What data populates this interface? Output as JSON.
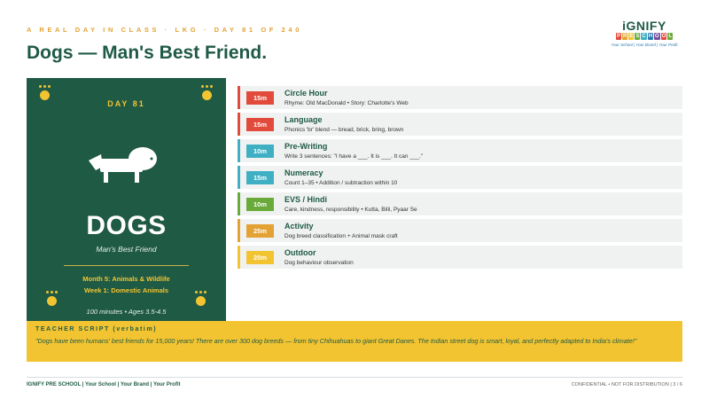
{
  "header": {
    "eyebrow": "A REAL DAY IN CLASS  ·  LKG  ·  DAY 81 OF 240",
    "title": "Dogs — Man's Best Friend."
  },
  "logo": {
    "word": "iGNIFY",
    "sub_letters": [
      "P",
      "R",
      "E",
      "S",
      "C",
      "H",
      "O",
      "O",
      "L"
    ],
    "sub_colors": [
      "#e24b3b",
      "#e3a233",
      "#f3c431",
      "#6aaa3a",
      "#3fb0c4",
      "#2a7ab0",
      "#7a4fa0",
      "#e24b3b",
      "#6aaa3a"
    ],
    "tagline": "Your School | Your Brand | Your Profit"
  },
  "card": {
    "day": "DAY 81",
    "icon": "dog-icon",
    "title": "DOGS",
    "subtitle": "Man's Best Friend",
    "line1": "Month 5: Animals & Wildlife",
    "line2": "Week 1: Domestic Animals",
    "footer": "100 minutes  •  Ages 3.5-4.5"
  },
  "schedule": [
    {
      "duration": "15m",
      "title": "Circle Hour",
      "desc": "Rhyme: Old MacDonald  •  Story: Charlotte's Web",
      "color": "#e24b3b"
    },
    {
      "duration": "15m",
      "title": "Language",
      "desc": "Phonics 'br' blend — bread, brick, bring, brown",
      "color": "#e24b3b"
    },
    {
      "duration": "10m",
      "title": "Pre-Writing",
      "desc": "Write 3 sentences:  \"I have a ___. It is ___. It can ___.\"",
      "color": "#3fb0c4"
    },
    {
      "duration": "15m",
      "title": "Numeracy",
      "desc": "Count 1–35  •  Addition / subtraction within 10",
      "color": "#3fb0c4"
    },
    {
      "duration": "10m",
      "title": "EVS / Hindi",
      "desc": "Care, kindness, responsibility  •  Kutta, Billi, Pyaar Se",
      "color": "#6aaa3a"
    },
    {
      "duration": "25m",
      "title": "Activity",
      "desc": "Dog breed classification  +  Animal mask craft",
      "color": "#e3a233"
    },
    {
      "duration": "20m",
      "title": "Outdoor",
      "desc": "Dog behaviour observation",
      "color": "#f3c431"
    }
  ],
  "script": {
    "heading": "TEACHER SCRIPT (verbatim)",
    "body": "\"Dogs have been humans' best friends for 15,000 years! There are over 300 dog breeds — from tiny Chihuahuas to giant Great Danes. The Indian street dog is smart, loyal, and perfectly adapted to India's climate!\""
  },
  "footer": {
    "left": "IGNIFY PRE SCHOOL  |  Your School  |  Your Brand  |  Your Profit",
    "right": "CONFIDENTIAL  •  NOT FOR DISTRIBUTION  |  3 / 6"
  }
}
